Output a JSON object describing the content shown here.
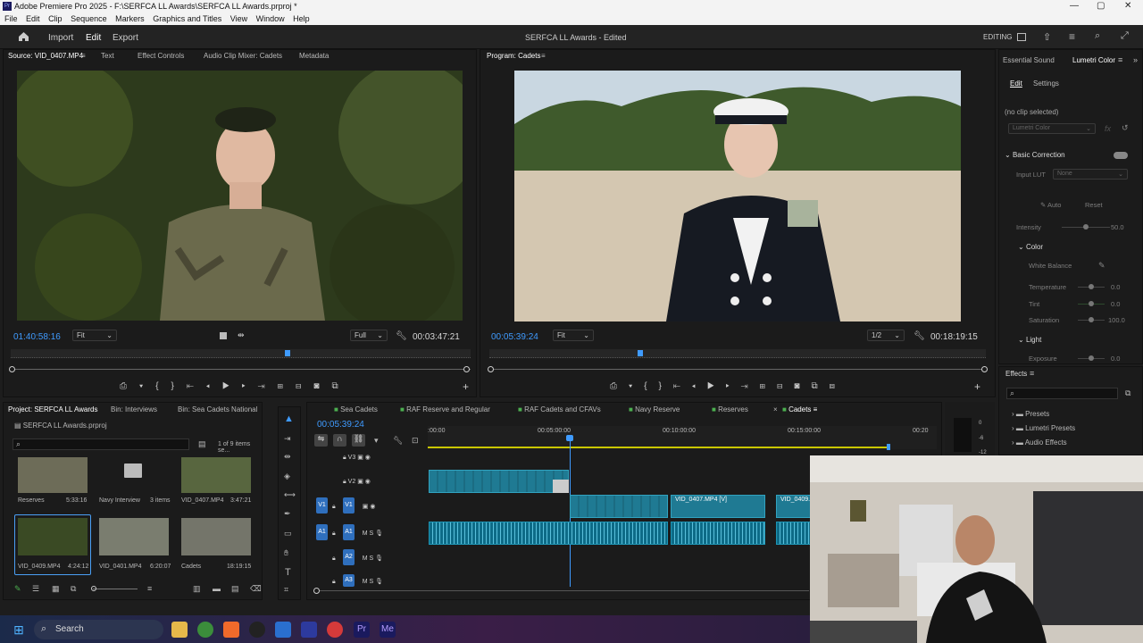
{
  "window": {
    "title": "Adobe Premiere Pro 2025 - F:\\SERFCA LL Awards\\SERFCA LL Awards.prproj *",
    "minimize": "—",
    "maximize": "▢",
    "close": "✕"
  },
  "menu": [
    "File",
    "Edit",
    "Clip",
    "Sequence",
    "Markers",
    "Graphics and Titles",
    "View",
    "Window",
    "Help"
  ],
  "appbar": {
    "nav": [
      "Import",
      "Edit",
      "Export"
    ],
    "center_title": "SERFCA LL Awards - Edited",
    "workspace": "EDITING"
  },
  "source_panel": {
    "tabs": [
      "Source: VID_0407.MP4",
      "Text",
      "Effect Controls",
      "Audio Clip Mixer: Cadets",
      "Metadata"
    ],
    "timecode_in": "01:40:58:16",
    "fit": "Fit",
    "quality": "Full",
    "timecode_dur": "00:03:47:21"
  },
  "program_panel": {
    "tab": "Program: Cadets",
    "timecode_in": "00:05:39:24",
    "fit": "Fit",
    "quality": "1/2",
    "timecode_dur": "00:18:19:15"
  },
  "right_panel": {
    "tabs": [
      "Essential Sound",
      "Lumetri Color"
    ],
    "subtabs": [
      "Edit",
      "Settings"
    ],
    "no_clip": "(no clip selected)",
    "effect_dd": "Lumetri Color",
    "basic_correction": "Basic Correction",
    "input_lut_label": "Input LUT",
    "input_lut_value": "None",
    "auto": "Auto",
    "reset": "Reset",
    "intensity": "Intensity",
    "intensity_val": "50.0",
    "color": "Color",
    "white_balance": "White Balance",
    "rows": [
      {
        "label": "Temperature",
        "val": "0.0"
      },
      {
        "label": "Tint",
        "val": "0.0"
      },
      {
        "label": "Saturation",
        "val": "100.0"
      }
    ],
    "light": "Light",
    "exposure": "Exposure",
    "exposure_val": "0.0"
  },
  "effects_panel": {
    "title": "Effects",
    "items": [
      "Presets",
      "Lumetri Presets",
      "Audio Effects"
    ]
  },
  "project_panel": {
    "tabs": [
      "Project: SERFCA LL Awards",
      "Bin: Interviews",
      "Bin: Sea Cadets National Bar"
    ],
    "file": "SERFCA LL Awards.prproj",
    "count": "1 of 9 items se...",
    "items": [
      {
        "name": "Reserves",
        "meta": "5:33:16"
      },
      {
        "name": "Navy Interview",
        "meta": "3 items"
      },
      {
        "name": "VID_0407.MP4",
        "meta": "3:47:21"
      },
      {
        "name": "VID_0409.MP4",
        "meta": "4:24:12"
      },
      {
        "name": "VID_0401.MP4",
        "meta": "6:20:07"
      },
      {
        "name": "Cadets",
        "meta": "18:19:15"
      }
    ]
  },
  "timeline": {
    "tabs": [
      "Sea Cadets",
      "RAF Reserve and Regular",
      "RAF Cadets and CFAVs",
      "Navy Reserve",
      "Reserves",
      "Cadets"
    ],
    "timecode": "00:05:39:24",
    "ruler": [
      ":00:00",
      "00:05:00:00",
      "00:10:00:00",
      "00:15:00:00",
      "00:20"
    ],
    "tracks": [
      "V3",
      "V2",
      "V1",
      "A1",
      "A2",
      "A3"
    ],
    "clip1": "VID_0407.MP4 [V]",
    "clip2": "VID_0409."
  },
  "meter": [
    "0",
    "-6",
    "-12"
  ],
  "taskbar": {
    "search": "Search"
  }
}
